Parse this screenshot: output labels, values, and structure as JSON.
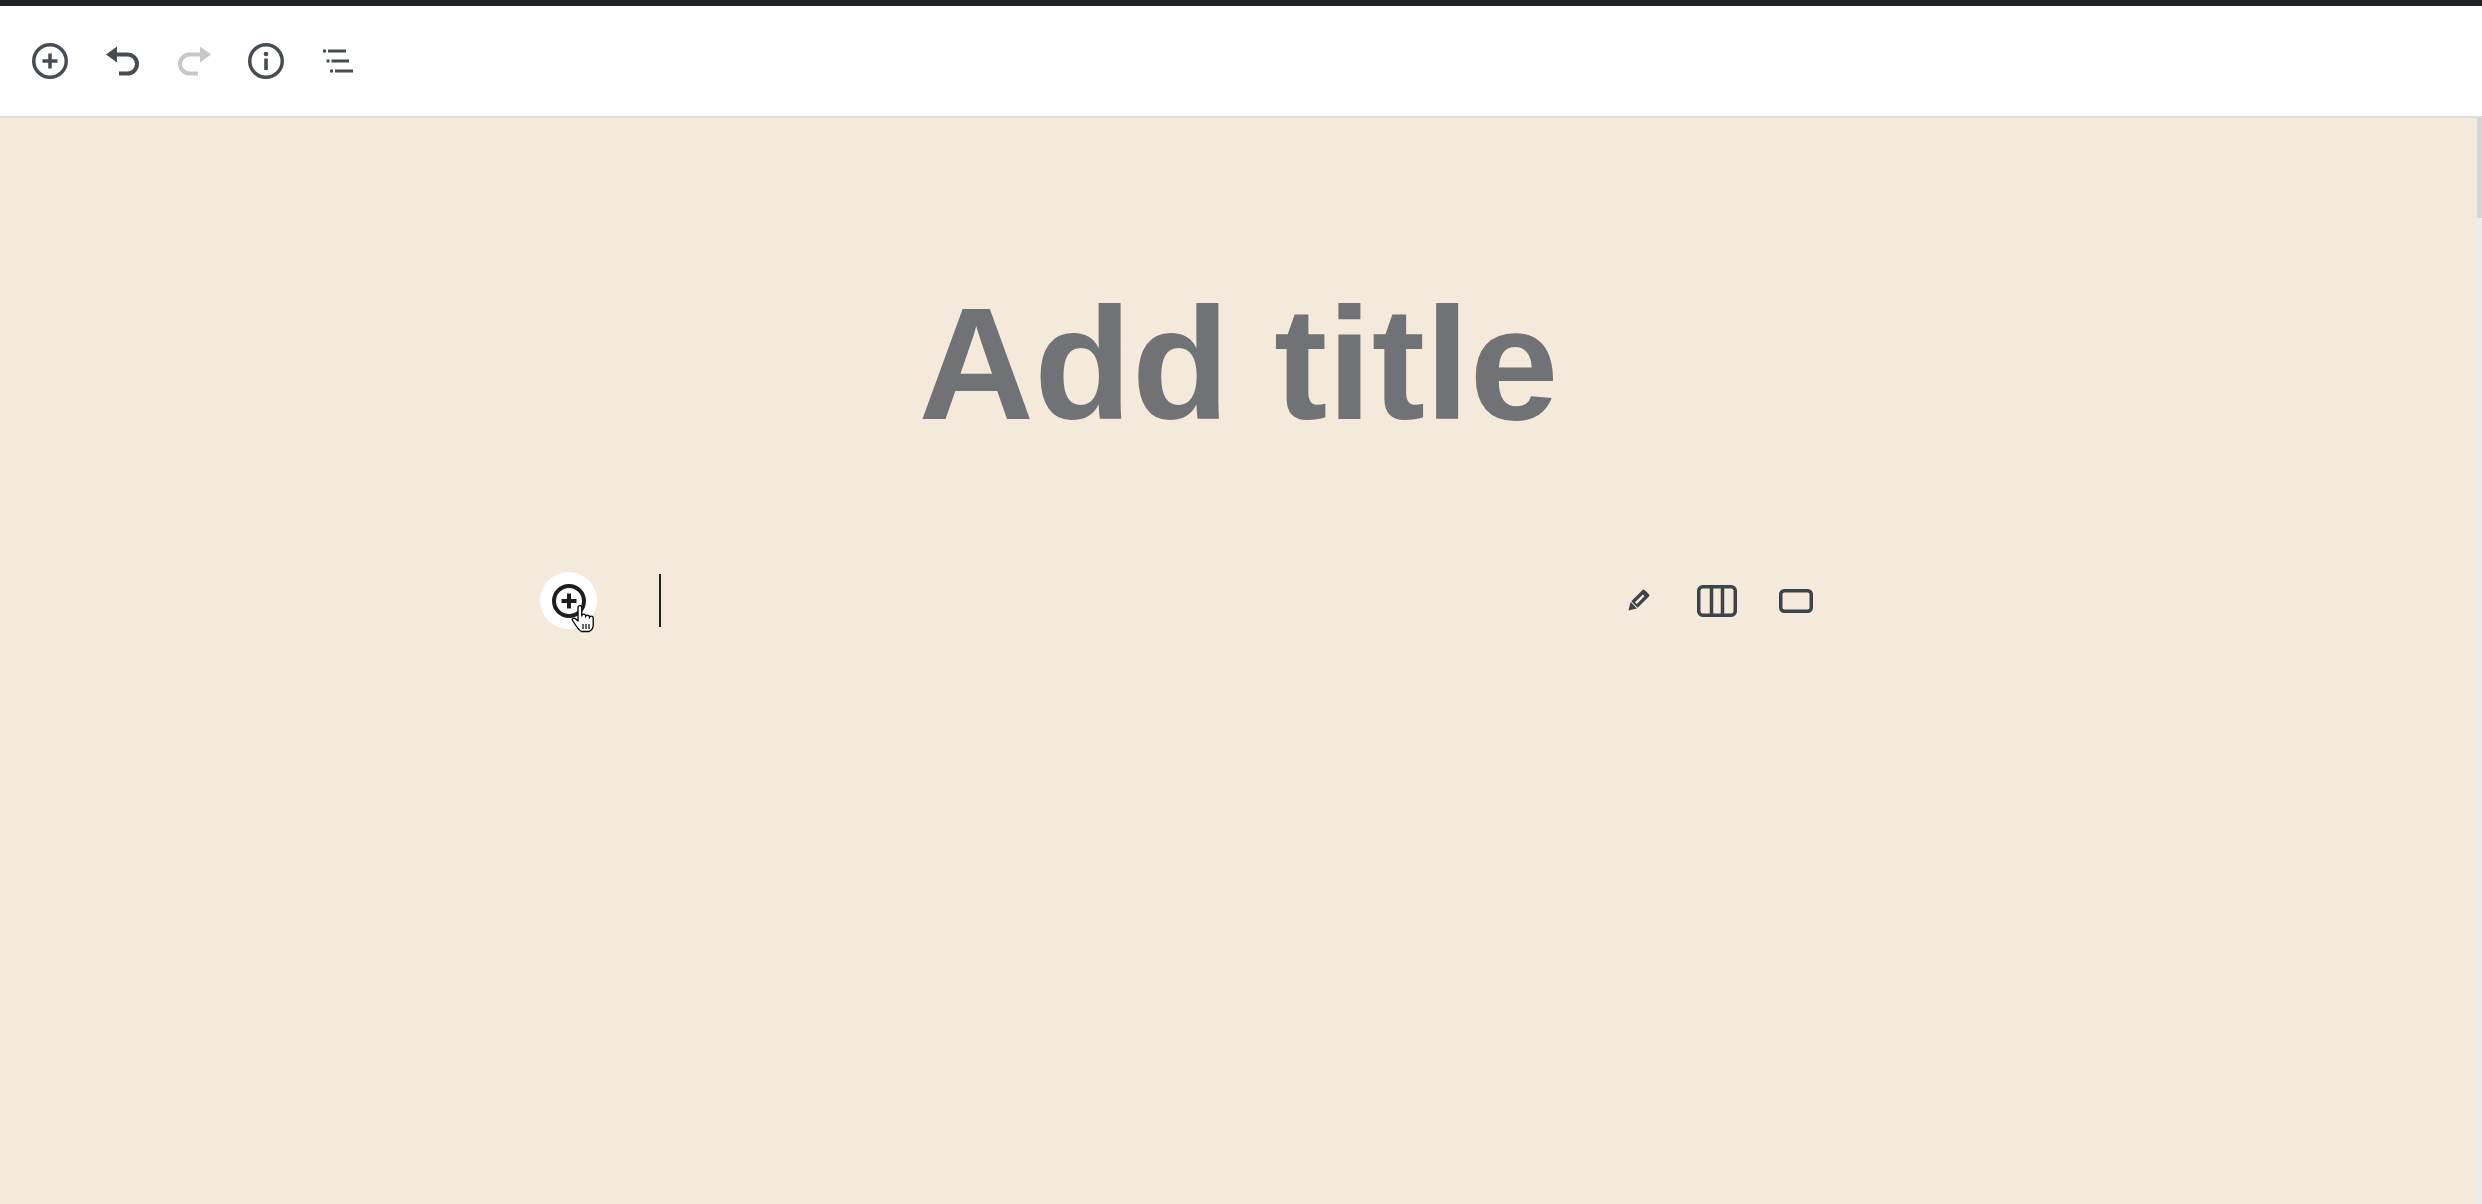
{
  "toolbar": {
    "buttons": [
      {
        "kind": "inserter",
        "disabled": false
      },
      {
        "kind": "undo",
        "disabled": false
      },
      {
        "kind": "redo",
        "disabled": true
      },
      {
        "kind": "info",
        "disabled": false
      },
      {
        "kind": "list_view",
        "disabled": false
      }
    ]
  },
  "editor": {
    "title": {
      "placeholder": "Add title"
    },
    "paragraph": {
      "focused": true
    },
    "block_tools": [
      {
        "kind": "edit"
      },
      {
        "kind": "columns"
      },
      {
        "kind": "wide"
      }
    ]
  }
}
